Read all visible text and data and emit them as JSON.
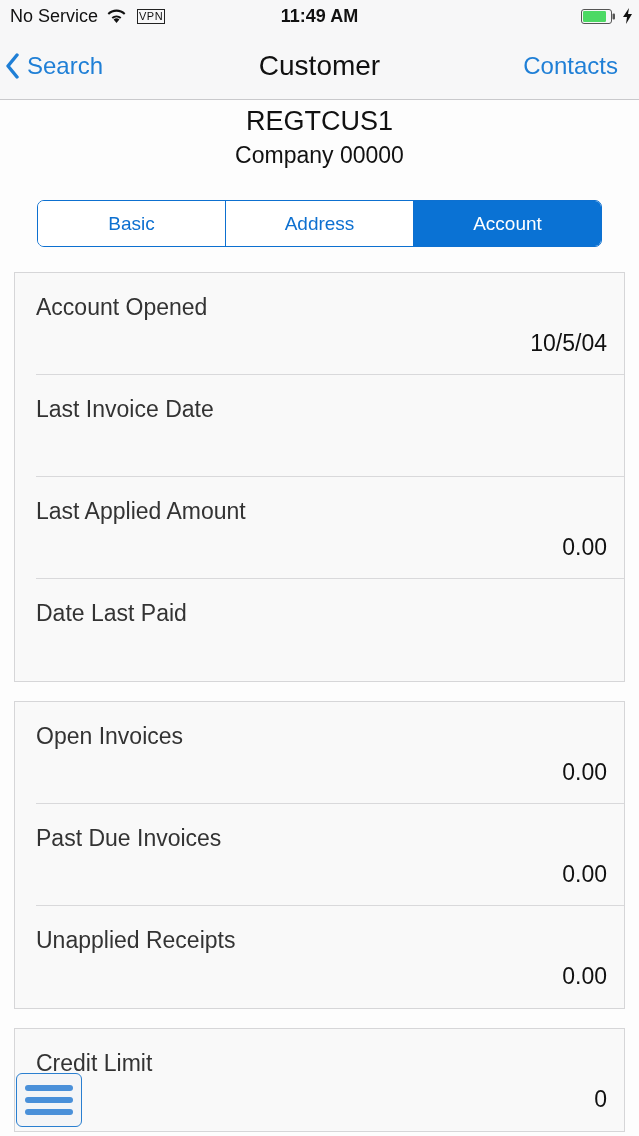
{
  "status_bar": {
    "carrier": "No Service",
    "vpn": "VPN",
    "time": "11:49 AM"
  },
  "nav_bar": {
    "back": "Search",
    "title": "Customer",
    "action": "Contacts"
  },
  "header": {
    "code": "REGTCUS1",
    "company": "Company 00000"
  },
  "tabs": [
    {
      "label": "Basic",
      "selected": false
    },
    {
      "label": "Address",
      "selected": false
    },
    {
      "label": "Account",
      "selected": true
    }
  ],
  "sections": [
    {
      "fields": [
        {
          "label": "Account Opened",
          "value": "10/5/04"
        },
        {
          "label": "Last Invoice Date"
        },
        {
          "label": "Last Applied Amount",
          "value": "0.00"
        },
        {
          "label": "Date Last Paid"
        }
      ]
    },
    {
      "fields": [
        {
          "label": "Open Invoices",
          "value": "0.00"
        },
        {
          "label": "Past Due Invoices",
          "value": "0.00"
        },
        {
          "label": "Unapplied Receipts",
          "value": "0.00"
        }
      ]
    },
    {
      "fields": [
        {
          "label": "Credit Limit",
          "value": "0"
        }
      ]
    }
  ]
}
